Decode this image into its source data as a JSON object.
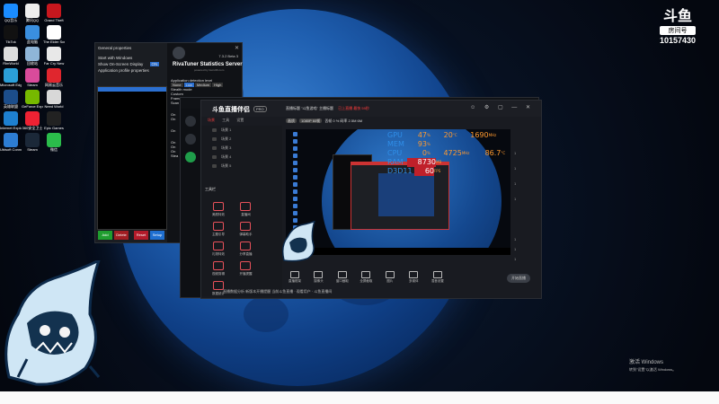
{
  "watermark": {
    "brand": "斗鱼",
    "sub": "房间号",
    "room": "10157430"
  },
  "activation": {
    "title": "激活 Windows",
    "hint": "转到\"设置\"以激活 Windows。"
  },
  "desktop_icons": [
    {
      "label": "QQ音乐",
      "color": "#1a8cff"
    },
    {
      "label": "腾讯QQ",
      "color": "#eeeeee"
    },
    {
      "label": "Grand Theft",
      "color": "#c7171e"
    },
    {
      "label": "TikTok",
      "color": "#111111"
    },
    {
      "label": "此电脑",
      "color": "#3a8fe0"
    },
    {
      "label": "The Elder Scrolls",
      "color": "#ffffff"
    },
    {
      "label": "RimWorld",
      "color": "#dddddd"
    },
    {
      "label": "回收站",
      "color": "#8fb6d8"
    },
    {
      "label": "Far Cry New",
      "color": "#e8e8e8"
    },
    {
      "label": "Microsoft Edge",
      "color": "#2b9fd9"
    },
    {
      "label": "Steam",
      "color": "#d94b9b"
    },
    {
      "label": "网易云音乐",
      "color": "#e0262e"
    },
    {
      "label": "英雄联盟",
      "color": "#1c4d8a"
    },
    {
      "label": "GeForce Experience",
      "color": "#76b900"
    },
    {
      "label": "Need World",
      "color": "#d8d8d8"
    },
    {
      "label": "Internet Explorer",
      "color": "#1e80d0"
    },
    {
      "label": "360安全卫士",
      "color": "#e23"
    },
    {
      "label": "Epic Games",
      "color": "#222222"
    },
    {
      "label": "Ubisoft Connect",
      "color": "#2d7dd2"
    },
    {
      "label": "Steam",
      "color": "#1b2838"
    },
    {
      "label": "微信",
      "color": "#2bbd4b"
    }
  ],
  "rtss": {
    "menu": [
      "General properties",
      "Start with Windows",
      "Show On-Screen Display",
      "Application profile properties"
    ],
    "toggle_on": "ON",
    "title": "RivaTuner Statistics Server",
    "subtitle": "powered by Guru3D.com",
    "version": "7.3.2 Beta 3",
    "detection_label": "Application detection level",
    "levels": [
      "None",
      "Low",
      "Medium",
      "High"
    ],
    "stealth": "Stealth mode",
    "rows": [
      "Custom",
      "Frame",
      "Scan",
      "On",
      "On",
      "On",
      "On",
      "On",
      "On",
      "Stea"
    ],
    "buttons": [
      {
        "label": "Add",
        "color": "#1f9d2f"
      },
      {
        "label": "Delete",
        "color": "#a01d22"
      },
      {
        "label": "Reset",
        "color": "#b31b2a"
      },
      {
        "label": "Setup",
        "color": "#1f6fd0"
      }
    ]
  },
  "app": {
    "brand": "斗鱼直播伴侣",
    "badge": "PRO",
    "tabs": [
      "场景",
      "工具",
      "设置"
    ],
    "scenes": [
      "场景 1",
      "场景 2",
      "场景 3",
      "场景 4",
      "场景 5"
    ],
    "tools_header": "工具栏",
    "tools": [
      "美颜特效",
      "直播间",
      "主题引导",
      "弹幕助手",
      "礼物特效",
      "分享直播",
      "视频剪辑",
      "开播提醒",
      "数据统计"
    ],
    "info_line": "直播标题 \"斗鱼游戏\" 主播标题",
    "status_hi": "已上直播  最快 59秒",
    "pills": [
      "画质",
      "1080P 60帧"
    ],
    "bitrate": "丢帧 0 % 码率 2.5M 6M",
    "osd": {
      "gpu_label": "GPU",
      "gpu_pct": "47",
      "gpu_pct_unit": "%",
      "gpu_temp": "20",
      "gpu_temp_unit": "°C",
      "gpu_clock": "1690",
      "gpu_clock_unit": "MHz",
      "mem_label": "MEM",
      "mem_pct": "93",
      "mem_pct_unit": "%",
      "cpu_label": "CPU",
      "cpu_pct": "0",
      "cpu_pct_unit": "%",
      "cpu_clock": "4725",
      "cpu_clock_unit": "MHz",
      "cpu_temp": "86.7",
      "cpu_temp_unit": "°C",
      "ram_label": "RAM",
      "ram_val": "8730",
      "ram_unit": "MB",
      "d3d_label": "D3D11",
      "fps": "60",
      "fps_unit": "FPS"
    },
    "right_col": [
      "1",
      "1",
      "1",
      "1",
      "1",
      "1",
      "1"
    ],
    "bottom_buttons": [
      "直播框架",
      "摄像头",
      "窗口截取",
      "全屏截取",
      "图片",
      "多媒体",
      "混音设置"
    ],
    "live_button": "开始直播",
    "footer": "直播数据分析  新版本开播提醒  当前斗鱼直播 · 观看用户 · 斗鱼直播间"
  }
}
